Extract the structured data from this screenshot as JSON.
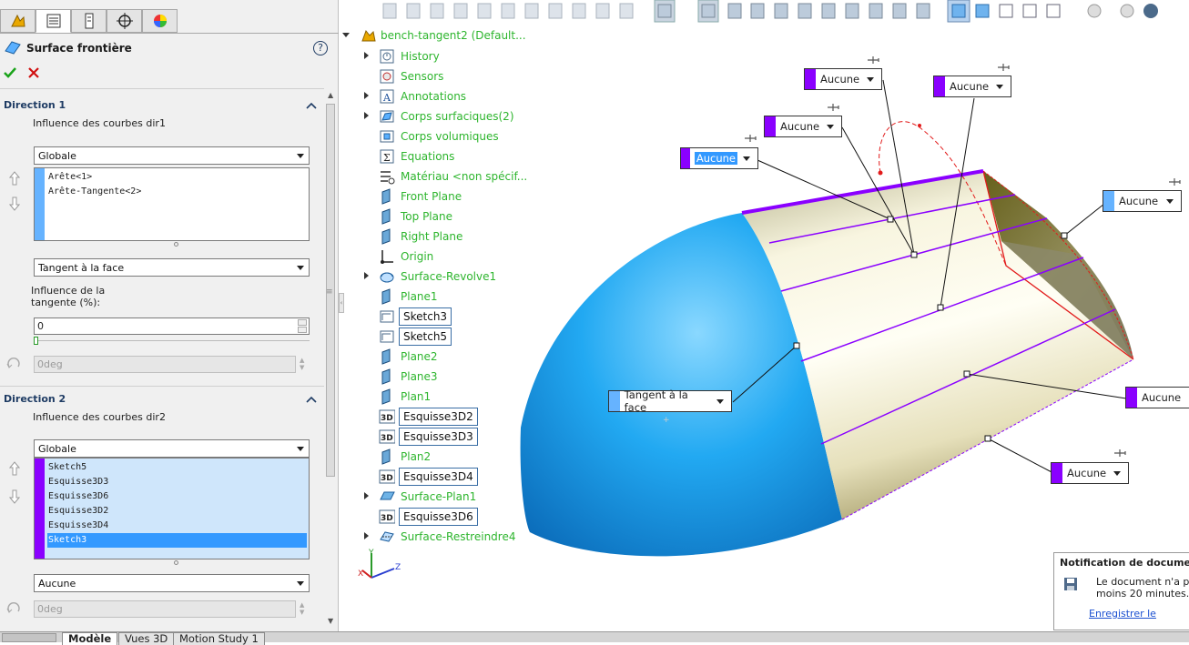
{
  "property_manager": {
    "tabs": [
      {
        "name": "feature-manager-tab"
      },
      {
        "name": "property-manager-tab"
      },
      {
        "name": "configuration-manager-tab"
      },
      {
        "name": "dimxpert-tab"
      },
      {
        "name": "display-manager-tab"
      }
    ],
    "title": "Surface frontière",
    "help": "?",
    "direction1": {
      "header": "Direction 1",
      "influence_label": "Influence des courbes dir1",
      "influence_value": "Globale",
      "curves": [
        "Arête<1>",
        "Arête-Tangente<2>"
      ],
      "curve_color": "#66b3ff",
      "tangent_type": "Tangent à la face",
      "tangent_influence_label": "Influence de la tangente (%):",
      "tangent_influence_value": "0",
      "angle": "0deg"
    },
    "direction2": {
      "header": "Direction 2",
      "influence_label": "Influence des courbes dir2",
      "influence_value": "Globale",
      "curves": [
        "Sketch5",
        "Esquisse3D3",
        "Esquisse3D6",
        "Esquisse3D2",
        "Esquisse3D4",
        "Sketch3"
      ],
      "selected_curve": "Sketch3",
      "curve_color": "#8a00ff",
      "tangent_type": "Aucune",
      "angle": "0deg"
    }
  },
  "feature_tree": {
    "root": "bench-tangent2  (Default...",
    "items": [
      {
        "label": "History",
        "icon": "history-icon",
        "expandable": true,
        "boxed": false
      },
      {
        "label": "Sensors",
        "icon": "sensor-icon",
        "expandable": false,
        "boxed": false
      },
      {
        "label": "Annotations",
        "icon": "annotation-icon",
        "expandable": true,
        "boxed": false
      },
      {
        "label": "Corps surfaciques(2)",
        "icon": "surface-bodies-icon",
        "expandable": true,
        "boxed": false
      },
      {
        "label": "Corps volumiques",
        "icon": "solid-bodies-icon",
        "expandable": false,
        "boxed": false
      },
      {
        "label": "Equations",
        "icon": "equation-icon",
        "expandable": false,
        "boxed": false
      },
      {
        "label": "Matériau <non spécif...",
        "icon": "material-icon",
        "expandable": false,
        "boxed": false
      },
      {
        "label": "Front Plane",
        "icon": "plane-icon",
        "expandable": false,
        "boxed": false
      },
      {
        "label": "Top Plane",
        "icon": "plane-icon",
        "expandable": false,
        "boxed": false
      },
      {
        "label": "Right Plane",
        "icon": "plane-icon",
        "expandable": false,
        "boxed": false
      },
      {
        "label": "Origin",
        "icon": "origin-icon",
        "expandable": false,
        "boxed": false
      },
      {
        "label": "Surface-Revolve1",
        "icon": "revolve-surface-icon",
        "expandable": true,
        "boxed": false
      },
      {
        "label": "Plane1",
        "icon": "plane-icon",
        "expandable": false,
        "boxed": false
      },
      {
        "label": "Sketch3",
        "icon": "sketch-icon",
        "expandable": false,
        "boxed": true
      },
      {
        "label": "Sketch5",
        "icon": "sketch-icon",
        "expandable": false,
        "boxed": true
      },
      {
        "label": "Plane2",
        "icon": "plane-icon",
        "expandable": false,
        "boxed": false
      },
      {
        "label": "Plane3",
        "icon": "plane-icon",
        "expandable": false,
        "boxed": false
      },
      {
        "label": "Plan1",
        "icon": "plane-icon",
        "expandable": false,
        "boxed": false
      },
      {
        "label": "Esquisse3D2",
        "icon": "sketch3d-icon",
        "expandable": false,
        "boxed": true
      },
      {
        "label": "Esquisse3D3",
        "icon": "sketch3d-icon",
        "expandable": false,
        "boxed": true
      },
      {
        "label": "Plan2",
        "icon": "plane-icon",
        "expandable": false,
        "boxed": false
      },
      {
        "label": "Esquisse3D4",
        "icon": "sketch3d-icon",
        "expandable": false,
        "boxed": true
      },
      {
        "label": "Surface-Plan1",
        "icon": "planar-surface-icon",
        "expandable": true,
        "boxed": false
      },
      {
        "label": "Esquisse3D6",
        "icon": "sketch3d-icon",
        "expandable": false,
        "boxed": true
      },
      {
        "label": "Surface-Restreindre4",
        "icon": "trim-surface-icon",
        "expandable": true,
        "boxed": false
      }
    ],
    "sketch3d_badge": "3D"
  },
  "viewport": {
    "callouts": [
      {
        "label": "Aucune",
        "highlight": false
      },
      {
        "label": "Aucune",
        "highlight": false
      },
      {
        "label": "Aucune",
        "highlight": false
      },
      {
        "label": "Aucune",
        "highlight": true
      },
      {
        "label": "Aucune",
        "highlight": false
      },
      {
        "label": "Tangent à la face",
        "highlight": false
      },
      {
        "label": "Aucune",
        "highlight": false
      },
      {
        "label": "Aucune",
        "highlight": false
      }
    ],
    "surface_blue": "#1fa0ee",
    "surface_cream": "#f4f0d6",
    "curve_purple": "#8a00ff",
    "axis_labels": {
      "x": "X",
      "y": "Y",
      "z": "Z"
    }
  },
  "notification": {
    "title": "Notification de document n",
    "body_line1": "Le document n'a pa",
    "body_line2": "moins 20 minutes.",
    "link": "Enregistrer le"
  },
  "bottom_tabs": [
    "Modèle",
    "Vues 3D",
    "Motion Study 1"
  ]
}
